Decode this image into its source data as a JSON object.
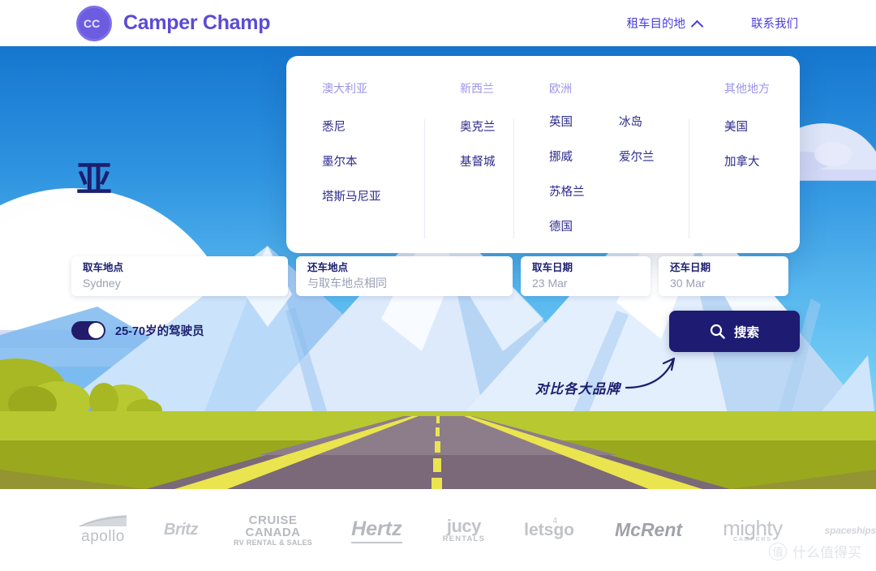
{
  "header": {
    "brand_name": "Camper Champ",
    "logo_text": "CC",
    "nav": [
      {
        "label": "租车目的地",
        "icon": "chevron-up-icon"
      },
      {
        "label": "联系我们",
        "icon": ""
      }
    ]
  },
  "hero": {
    "headline": "亚"
  },
  "dropdown": {
    "columns": [
      {
        "heading": "澳大利亚",
        "links": [
          "悉尼",
          "墨尔本",
          "塔斯马尼亚"
        ]
      },
      {
        "heading": "新西兰",
        "links": [
          "奥克兰",
          "基督城"
        ]
      },
      {
        "heading": "欧洲",
        "links_a": [
          "英国",
          "挪威",
          "苏格兰",
          "德国"
        ],
        "links_b": [
          "冰岛",
          "爱尔兰"
        ]
      },
      {
        "heading": "其他地方",
        "links": [
          "美国",
          "加拿大"
        ]
      }
    ]
  },
  "search_form": {
    "fields": [
      {
        "label": "取车地点",
        "value": "Sydney"
      },
      {
        "label": "还车地点",
        "value": "与取车地点相同"
      },
      {
        "label": "取车日期",
        "value": "23 Mar"
      },
      {
        "label": "还车日期",
        "value": "30 Mar"
      }
    ],
    "toggle": {
      "label": "25-70岁的驾驶员",
      "state": "on"
    },
    "search_button": {
      "label": "搜索",
      "icon": "search-icon"
    },
    "annotation": "对比各大品牌"
  },
  "logos": [
    {
      "name": "apollo",
      "text": "apollo"
    },
    {
      "name": "britz",
      "text": "Britz"
    },
    {
      "name": "cruise-canada",
      "line1": "CRUISE",
      "line2": "CANADA",
      "line3": "RV RENTAL & SALES"
    },
    {
      "name": "hertz",
      "text": "Hertz"
    },
    {
      "name": "jucy",
      "line1": "jucy",
      "line2": "RENTALS"
    },
    {
      "name": "letsgo",
      "text": "letsgo",
      "sup": "4"
    },
    {
      "name": "mcrent",
      "text": "McRent"
    },
    {
      "name": "mighty",
      "line1": "mighty",
      "line2": "CAMPERS"
    },
    {
      "name": "spaceships",
      "text": "spaceships"
    }
  ],
  "watermark": {
    "mark": "值",
    "text": "什么值得买"
  },
  "colors": {
    "brand_purple": "#5b4bd6",
    "nav_blue": "#4a3ae0",
    "deep_navy": "#1e1b72",
    "dropdown_heading": "#9b94e8",
    "dropdown_link": "#2b2a8c",
    "sky_top": "#1676cf",
    "sky_bottom": "#8fdcf8",
    "grass": "#b7c831"
  }
}
